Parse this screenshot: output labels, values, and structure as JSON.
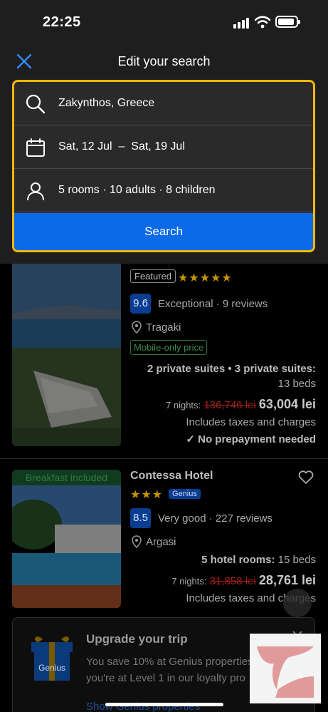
{
  "status_bar": {
    "time": "22:25"
  },
  "header": {
    "title": "Edit your search",
    "destination": "Zakynthos, Greece",
    "dates": "Sat, 12 Jul  –  Sat, 19 Jul",
    "guests": "5 rooms · 10 adults · 8 children",
    "search_label": "Search"
  },
  "results": [
    {
      "badge": "Featured",
      "stars": "★★★★★",
      "score": "9.6",
      "rating_text": "Exceptional",
      "reviews": "· 9 reviews",
      "location": "Tragaki",
      "tag": "Mobile-only price",
      "rooms_bold": "2 private suites • 3 private suites:",
      "beds": "13 beds",
      "nights": "7 nights:",
      "old_price": "136,746 lei",
      "price": "63,004 lei",
      "taxes": "Includes taxes and charges",
      "prepay": "✓ No prepayment needed"
    },
    {
      "ribbon": "Breakfast included",
      "name": "Contessa Hotel",
      "stars": "★★★",
      "genius": "Genius",
      "score": "8.5",
      "rating_text": "Very good",
      "reviews": "· 227 reviews",
      "location": "Argasi",
      "rooms_bold": "5 hotel rooms:",
      "beds": "15 beds",
      "nights": "7 nights:",
      "old_price": "31,858 lei",
      "price": "28,761 lei",
      "taxes": "Includes taxes and charges"
    }
  ],
  "upgrade": {
    "gift_label": "Genius",
    "title": "Upgrade your trip",
    "text": "You save 10% at Genius properties – you're at Level 1 in our loyalty pro",
    "link": "Show Genius properties"
  },
  "colors": {
    "accent": "#0a6ae8",
    "highlight_border": "#f5b800"
  }
}
